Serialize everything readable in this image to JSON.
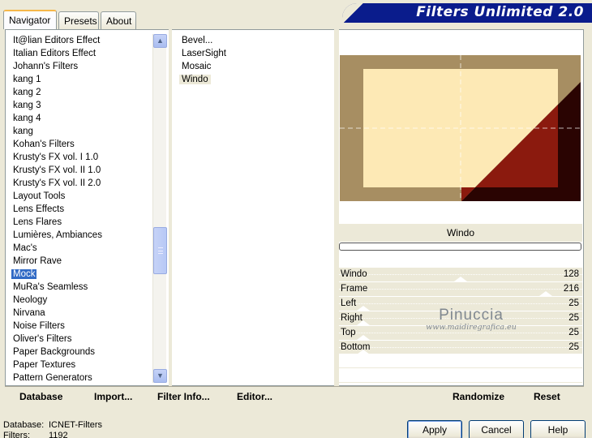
{
  "tabs": [
    {
      "label": "Navigator",
      "active": true
    },
    {
      "label": "Presets",
      "active": false
    },
    {
      "label": "About",
      "active": false
    }
  ],
  "logo": {
    "text": "Filters Unlimited 2.0"
  },
  "categories": [
    "It@lian Editors Effect",
    "Italian Editors Effect",
    "Johann's Filters",
    "kang 1",
    "kang 2",
    "kang 3",
    "kang 4",
    "kang",
    "Kohan's Filters",
    "Krusty's FX vol. I 1.0",
    "Krusty's FX vol. II 1.0",
    "Krusty's FX vol. II 2.0",
    "Layout Tools",
    "Lens Effects",
    "Lens Flares",
    "Lumières, Ambiances",
    "Mac's",
    "Mirror Rave",
    "Mock",
    "MuRa's Seamless",
    "Neology",
    "Nirvana",
    "Noise Filters",
    "Oliver's Filters",
    "Paper Backgrounds",
    "Paper Textures",
    "Pattern Generators"
  ],
  "selected_category": "Mock",
  "filters": [
    "Bevel...",
    "LaserSight",
    "Mosaic",
    "Windo"
  ],
  "selected_filter": "Windo",
  "preview": {
    "frame_color": "#a78e62",
    "inner_color": "#fde9b5",
    "triangle_color": "#8b1a0e",
    "dark_color": "#2a0402"
  },
  "filter_name": "Windo",
  "sliders": [
    {
      "label": "Windo",
      "value": "128",
      "fraction": 0.5
    },
    {
      "label": "Frame",
      "value": "216",
      "fraction": 0.85
    },
    {
      "label": "Left",
      "value": "25",
      "fraction": 0.1
    },
    {
      "label": "Right",
      "value": "25",
      "fraction": 0.1
    },
    {
      "label": "Top",
      "value": "25",
      "fraction": 0.1
    },
    {
      "label": "Bottom",
      "value": "25",
      "fraction": 0.1
    }
  ],
  "watermark": {
    "main": "Pinuccia",
    "sub": "www.maidiregrafica.eu"
  },
  "toolbar": {
    "database": "Database",
    "import": "Import...",
    "filter_info": "Filter Info...",
    "editor": "Editor...",
    "randomize": "Randomize",
    "reset": "Reset"
  },
  "status": {
    "database_key": "Database:",
    "database_value": "ICNET-Filters",
    "filters_key": "Filters:",
    "filters_value": "1192"
  },
  "buttons": {
    "apply": "Apply",
    "cancel": "Cancel",
    "help": "Help"
  }
}
